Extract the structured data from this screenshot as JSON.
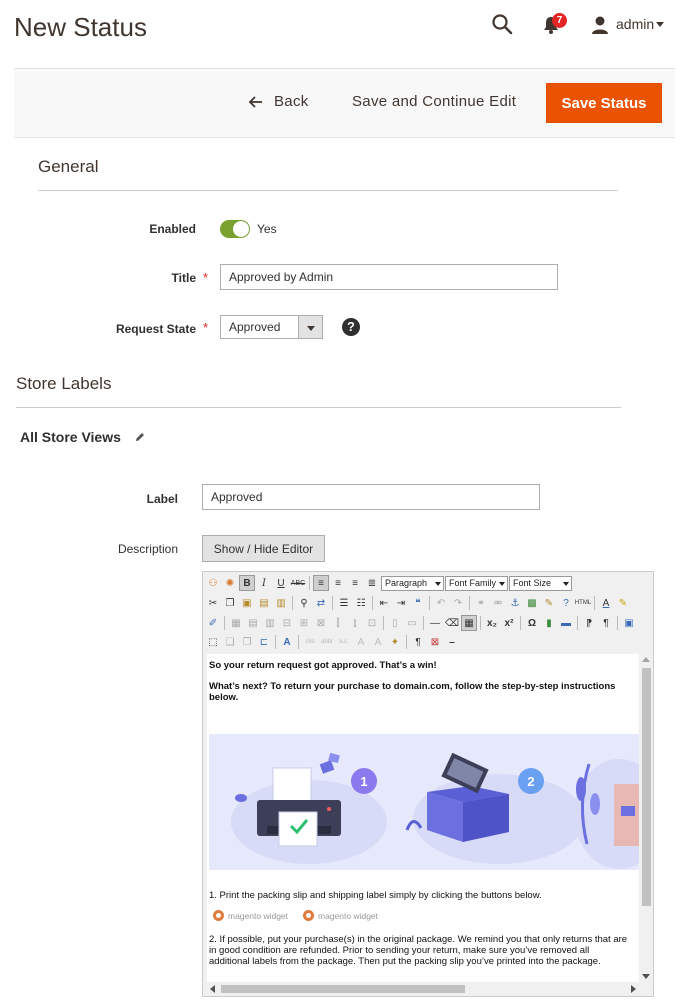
{
  "header": {
    "page_title": "New Status",
    "notifications_count": "7",
    "user_name": "admin"
  },
  "actions": {
    "back_label": "Back",
    "save_continue_label": "Save and Continue Edit",
    "save_label": "Save Status"
  },
  "general": {
    "section_title": "General",
    "enabled_label": "Enabled",
    "enabled_value": "Yes",
    "title_label": "Title",
    "title_value": "Approved by Admin",
    "request_state_label": "Request State",
    "request_state_value": "Approved",
    "help_glyph": "?"
  },
  "store_labels": {
    "section_title": "Store Labels",
    "store_view_title": "All Store Views",
    "label_label": "Label",
    "label_value": "Approved",
    "description_label": "Description",
    "show_hide_editor": "Show / Hide Editor"
  },
  "editor": {
    "format_select": "Paragraph",
    "font_family_select": "Font Family",
    "font_size_select": "Font Size",
    "content": {
      "heading": "So your return request got approved. That’s a win!",
      "intro": "What’s next? To return your purchase to domain.com, follow the step-by-step instructions below.",
      "step_1_badge": "1",
      "step_2_badge": "2",
      "step1_text": "1. Print the packing slip and shipping label simply by clicking the buttons below.",
      "widget_1": "magento widget",
      "widget_2": "magento widget",
      "step2_text": "2. If possible, put your purchase(s) in the original package. We remind you that only returns that are in good condition are refunded. Prior to sending your return, make sure you’ve removed all additional labels from the package. Then put the packing slip you’ve printed into the package."
    }
  },
  "colors": {
    "accent": "#eb5202",
    "toggle_on": "#79a22e",
    "badge": "#e22626",
    "illustration_bg": "#e4e8fb",
    "illustration_primary": "#6b6fe0"
  }
}
